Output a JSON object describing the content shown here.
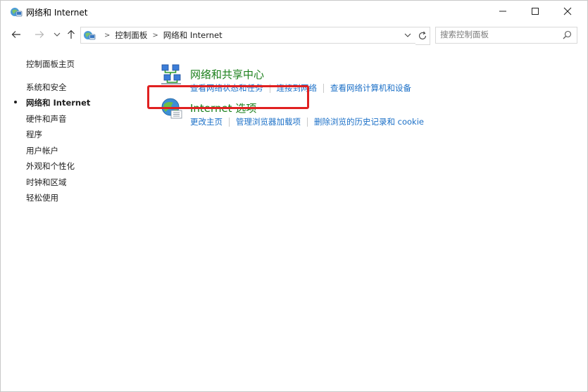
{
  "window": {
    "title": "网络和 Internet"
  },
  "address": {
    "crumbs": [
      "控制面板",
      "网络和 Internet"
    ]
  },
  "search": {
    "placeholder": "搜索控制面板"
  },
  "sidebar": {
    "items": [
      {
        "label": "控制面板主页",
        "active": false
      },
      {
        "label": "系统和安全",
        "active": false
      },
      {
        "label": "网络和 Internet",
        "active": true
      },
      {
        "label": "硬件和声音",
        "active": false
      },
      {
        "label": "程序",
        "active": false
      },
      {
        "label": "用户帐户",
        "active": false
      },
      {
        "label": "外观和个性化",
        "active": false
      },
      {
        "label": "时钟和区域",
        "active": false
      },
      {
        "label": "轻松使用",
        "active": false
      }
    ]
  },
  "categories": [
    {
      "title": "网络和共享中心",
      "icon": "network-sharing-icon",
      "links": [
        "查看网络状态和任务",
        "连接到网络",
        "查看网络计算机和设备"
      ]
    },
    {
      "title": "Internet 选项",
      "icon": "internet-options-globe-icon",
      "links": [
        "更改主页",
        "管理浏览器加载项",
        "删除浏览的历史记录和 cookie"
      ]
    }
  ],
  "colors": {
    "category_title": "#1b7f1b",
    "link": "#1a6fc7",
    "highlight": "#e02020"
  }
}
